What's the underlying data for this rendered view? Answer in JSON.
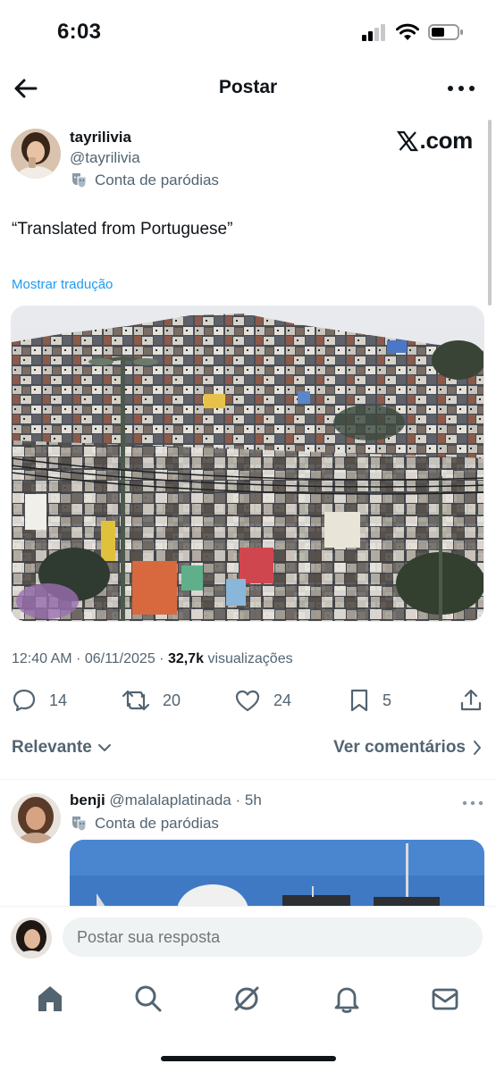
{
  "status_bar": {
    "time": "6:03"
  },
  "header": {
    "title": "Postar"
  },
  "post": {
    "author_name": "tayrilivia",
    "author_handle": "@tayrilivia",
    "parody_label": "Conta de paródias",
    "source_label": ".com",
    "text": "“Translated from Portuguese”",
    "translate_link": "Mostrar tradução",
    "image_alt": "Favela hillside with dense colorful houses",
    "time": "12:40 AM",
    "date": "06/11/2025",
    "views_count": "32,7k",
    "views_label": "visualizações",
    "actions": {
      "replies": "14",
      "reposts": "20",
      "likes": "24",
      "bookmarks": "5"
    }
  },
  "sort": {
    "left_label": "Relevante",
    "right_label": "Ver comentários"
  },
  "reply": {
    "name": "benji",
    "handle": "@malalaplatinada",
    "time": "5h",
    "parody_label": "Conta de paródias"
  },
  "composer": {
    "placeholder": "Postar sua resposta"
  },
  "colors": {
    "text": "#0f1419",
    "secondary": "#536471",
    "link": "#1d9bf0",
    "input_bg": "#eff3f4"
  }
}
